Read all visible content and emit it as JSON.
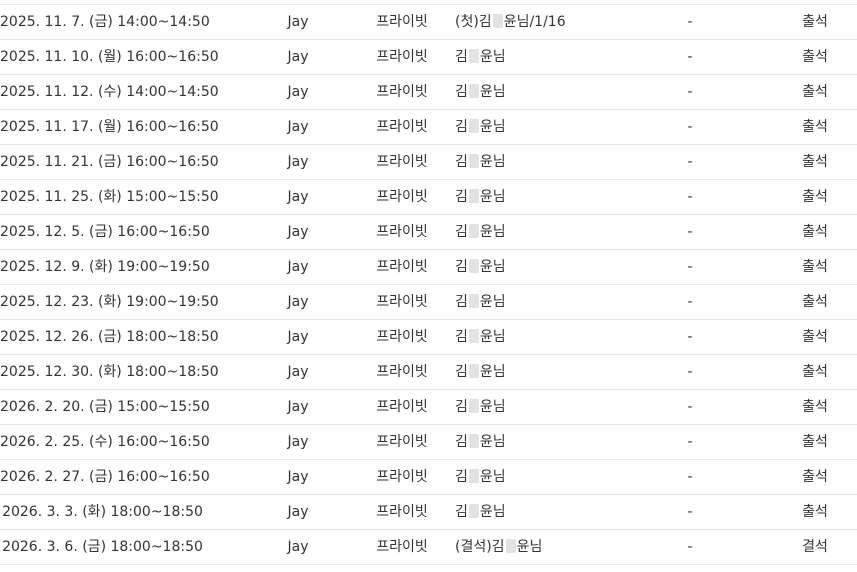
{
  "rows": [
    {
      "date": "2025. 11. 7. (금) 14:00~14:50",
      "teacher": "Jay",
      "type": "프라이빗",
      "student_prefix": "(첫)김",
      "student_suffix": "윤님/1/16",
      "note": "-",
      "status": "출석"
    },
    {
      "date": "2025. 11. 10. (월) 16:00~16:50",
      "teacher": "Jay",
      "type": "프라이빗",
      "student_prefix": "김",
      "student_suffix": "윤님",
      "note": "-",
      "status": "출석"
    },
    {
      "date": "2025. 11. 12. (수) 14:00~14:50",
      "teacher": "Jay",
      "type": "프라이빗",
      "student_prefix": "김",
      "student_suffix": "윤님",
      "note": "-",
      "status": "출석"
    },
    {
      "date": "2025. 11. 17. (월) 16:00~16:50",
      "teacher": "Jay",
      "type": "프라이빗",
      "student_prefix": "김",
      "student_suffix": "윤님",
      "note": "-",
      "status": "출석"
    },
    {
      "date": "2025. 11. 21. (금) 16:00~16:50",
      "teacher": "Jay",
      "type": "프라이빗",
      "student_prefix": "김",
      "student_suffix": "윤님",
      "note": "-",
      "status": "출석"
    },
    {
      "date": "2025. 11. 25. (화) 15:00~15:50",
      "teacher": "Jay",
      "type": "프라이빗",
      "student_prefix": "김",
      "student_suffix": "윤님",
      "note": "-",
      "status": "출석"
    },
    {
      "date": "2025. 12. 5. (금) 16:00~16:50",
      "teacher": "Jay",
      "type": "프라이빗",
      "student_prefix": "김",
      "student_suffix": "윤님",
      "note": "-",
      "status": "출석"
    },
    {
      "date": "2025. 12. 9. (화) 19:00~19:50",
      "teacher": "Jay",
      "type": "프라이빗",
      "student_prefix": "김",
      "student_suffix": "윤님",
      "note": "-",
      "status": "출석"
    },
    {
      "date": "2025. 12. 23. (화) 19:00~19:50",
      "teacher": "Jay",
      "type": "프라이빗",
      "student_prefix": "김",
      "student_suffix": "윤님",
      "note": "-",
      "status": "출석"
    },
    {
      "date": "2025. 12. 26. (금) 18:00~18:50",
      "teacher": "Jay",
      "type": "프라이빗",
      "student_prefix": "김",
      "student_suffix": "윤님",
      "note": "-",
      "status": "출석"
    },
    {
      "date": "2025. 12. 30. (화) 18:00~18:50",
      "teacher": "Jay",
      "type": "프라이빗",
      "student_prefix": "김",
      "student_suffix": "윤님",
      "note": "-",
      "status": "출석"
    },
    {
      "date": "2026. 2. 20. (금) 15:00~15:50",
      "teacher": "Jay",
      "type": "프라이빗",
      "student_prefix": "김",
      "student_suffix": "윤님",
      "note": "-",
      "status": "출석"
    },
    {
      "date": "2026. 2. 25. (수) 16:00~16:50",
      "teacher": "Jay",
      "type": "프라이빗",
      "student_prefix": "김",
      "student_suffix": "윤님",
      "note": "-",
      "status": "출석"
    },
    {
      "date": "2026. 2. 27. (금) 16:00~16:50",
      "teacher": "Jay",
      "type": "프라이빗",
      "student_prefix": "김",
      "student_suffix": "윤님",
      "note": "-",
      "status": "출석"
    },
    {
      "date": "2026. 3. 3. (화) 18:00~18:50",
      "teacher": "Jay",
      "type": "프라이빗",
      "student_prefix": "김",
      "student_suffix": "윤님",
      "note": "-",
      "status": "출석"
    },
    {
      "date": "2026. 3. 6. (금) 18:00~18:50",
      "teacher": "Jay",
      "type": "프라이빗",
      "student_prefix": "(결석)김",
      "student_suffix": "윤님",
      "note": "-",
      "status": "결석"
    }
  ]
}
